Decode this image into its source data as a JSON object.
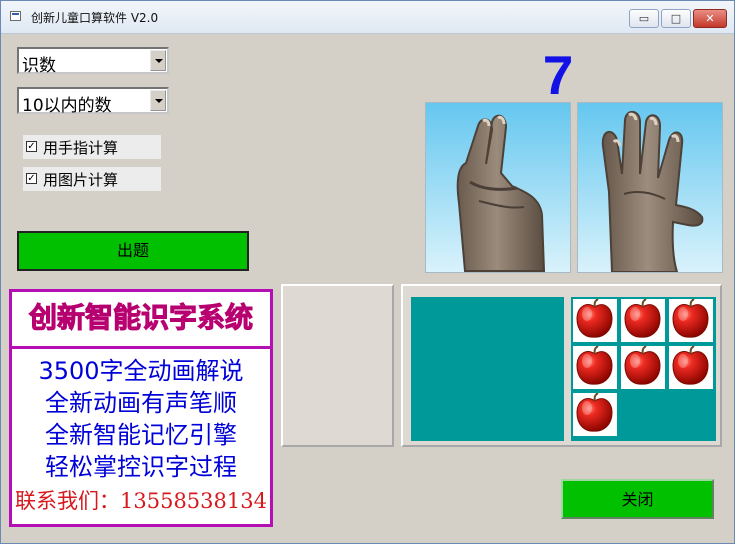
{
  "window": {
    "title": "创新儿童口算软件 V2.0",
    "minimize_label": "▭",
    "restore_label": "□",
    "close_label": "✕"
  },
  "controls": {
    "mode_select": "识数",
    "range_select": "10以内的数",
    "finger_calc_label": "用手指计算",
    "finger_calc_checked": true,
    "picture_calc_label": "用图片计算",
    "picture_calc_checked": true,
    "question_button": "出题",
    "close_button": "关闭"
  },
  "display": {
    "answer": "7",
    "left_hand_value": 2,
    "right_hand_value": 5,
    "apple_count": 7
  },
  "ad": {
    "title": "创新智能识字系统",
    "lines": [
      "3500字全动画解说",
      "全新动画有声笔顺",
      "全新智能记忆引擎",
      "轻松掌控识字过程"
    ],
    "contact": "联系我们：13558538134"
  },
  "colors": {
    "background": "#d4d0c8",
    "button_green": "#00c000",
    "answer_blue": "#1212e6",
    "teal": "#00999a",
    "ad_magenta": "#b40fb4",
    "ad_title_pink": "#ff0f8b",
    "ad_blue": "#0000d8",
    "ad_red": "#d7191c"
  },
  "icons": {
    "app": "app-window-icon",
    "dropdown": "dropdown-arrow-icon",
    "checkbox": "checkmark-icon",
    "apple": "apple-icon"
  }
}
